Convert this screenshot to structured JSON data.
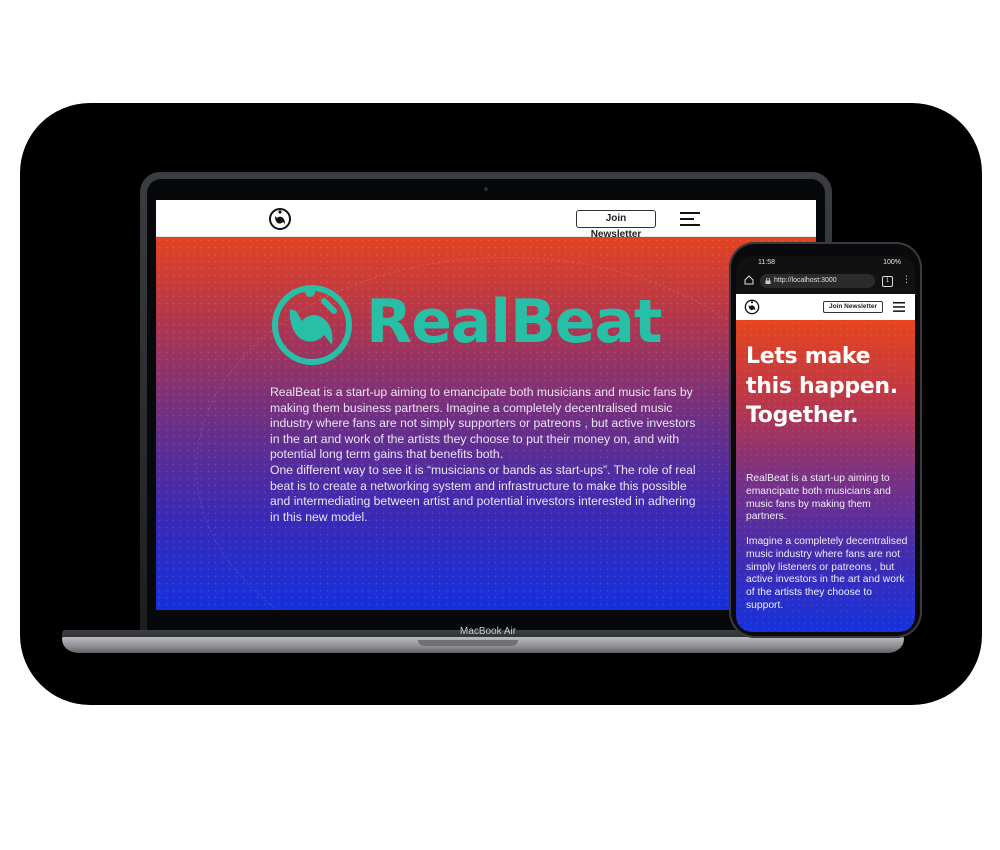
{
  "laptop": {
    "model_label": "MacBook Air",
    "nav": {
      "newsletter_label": "Join Newsletter",
      "logo_icon": "realbeat-logo-icon",
      "menu_icon": "hamburger-menu-icon"
    },
    "hero": {
      "brand_name": "RealBeat",
      "paragraph_1": "RealBeat is a start-up aiming to emancipate both musicians and music fans by making them business partners. Imagine a completely decentralised music industry where fans are not simply supporters or patreons , but active investors in the art and work of the artists they choose to put their money on, and with potential long term gains that benefits both.",
      "paragraph_2": "One different way to see it is “musicians or bands as start-ups”. The role of real beat is to create a networking system and infrastructure to make this possible and intermediating between artist and potential investors interested in adhering in this new model."
    }
  },
  "phone": {
    "status": {
      "time": "11:58",
      "battery": "100%"
    },
    "browser": {
      "url": "http://localhost:3000",
      "tab_count": "1"
    },
    "nav": {
      "newsletter_label": "Join Newsletter"
    },
    "hero": {
      "headline": "Lets make this happen. Together.",
      "paragraph_1": "RealBeat is a start-up aiming to emancipate both musicians and music fans by making them partners.",
      "paragraph_2": "Imagine a completely decentralised music industry where fans are not simply listeners or patreons , but active investors in the art and work of the artists they choose to support."
    }
  },
  "colors": {
    "brand_teal": "#27bfa6",
    "gradient_top": "#e34321",
    "gradient_bottom": "#1430dc"
  }
}
